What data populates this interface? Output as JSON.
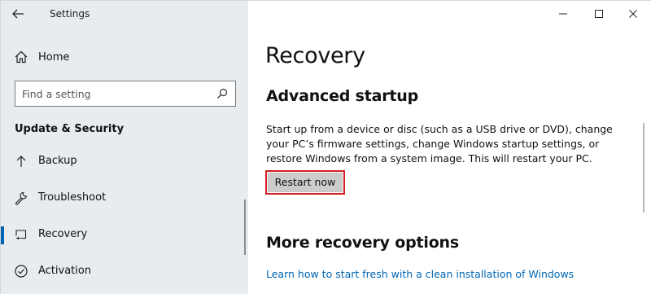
{
  "window": {
    "title": "Settings"
  },
  "sidebar": {
    "home_label": "Home",
    "search": {
      "placeholder": "Find a setting"
    },
    "section_heading": "Update & Security",
    "items": [
      {
        "label": "Backup",
        "icon": "arrow-up-icon",
        "selected": false
      },
      {
        "label": "Troubleshoot",
        "icon": "wrench-icon",
        "selected": false
      },
      {
        "label": "Recovery",
        "icon": "recovery-icon",
        "selected": true
      },
      {
        "label": "Activation",
        "icon": "check-circle-icon",
        "selected": false
      }
    ]
  },
  "main": {
    "page_title": "Recovery",
    "advanced_startup": {
      "heading": "Advanced startup",
      "description": "Start up from a device or disc (such as a USB drive or DVD), change your PC’s firmware settings, change Windows startup settings, or restore Windows from a system image. This will restart your PC.",
      "button_label": "Restart now"
    },
    "more_options": {
      "heading": "More recovery options",
      "link_label": "Learn how to start fresh with a clean installation of Windows"
    }
  },
  "colors": {
    "sidebar_bg": "#e8ecef",
    "accent": "#0063b1",
    "link": "#0066b4",
    "highlight": "#d41f26",
    "button_bg": "#cccccc"
  }
}
